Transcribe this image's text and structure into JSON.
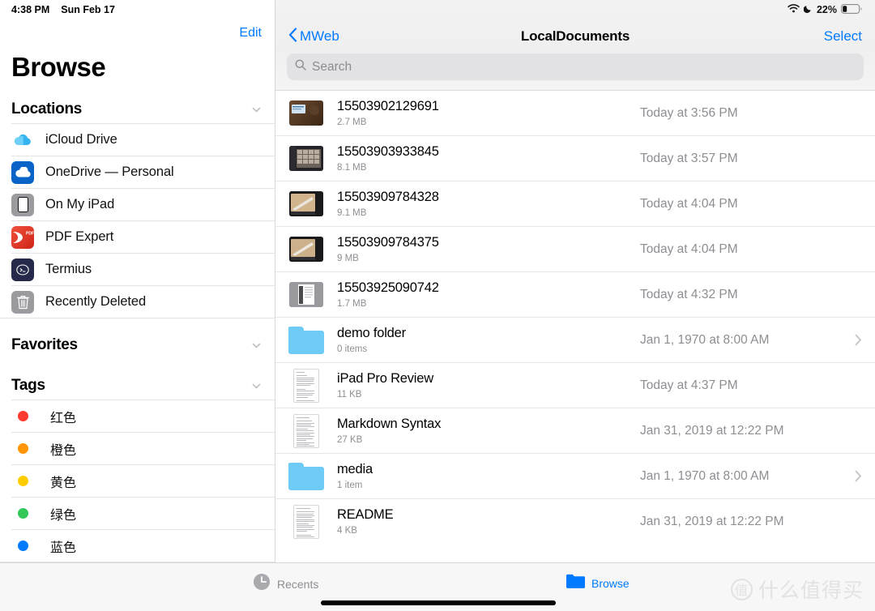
{
  "status_bar": {
    "time": "4:38 PM",
    "date": "Sun Feb 17",
    "wifi_icon": "wifi-icon",
    "dnd_icon": "moon-icon",
    "battery_percent": "22%",
    "battery_icon": "battery-icon"
  },
  "sidebar": {
    "edit_label": "Edit",
    "title": "Browse",
    "sections": [
      {
        "name": "locations",
        "title": "Locations",
        "collapse_icon": "chevron-down-icon",
        "items": [
          {
            "label": "iCloud Drive",
            "icon": "icloud-icon"
          },
          {
            "label": "OneDrive — Personal",
            "icon": "onedrive-icon"
          },
          {
            "label": "On My iPad",
            "icon": "ipad-icon"
          },
          {
            "label": "PDF Expert",
            "icon": "pdf-expert-icon"
          },
          {
            "label": "Termius",
            "icon": "termius-icon"
          },
          {
            "label": "Recently Deleted",
            "icon": "trash-icon"
          }
        ]
      },
      {
        "name": "favorites",
        "title": "Favorites",
        "collapse_icon": "chevron-down-icon",
        "items": []
      },
      {
        "name": "tags",
        "title": "Tags",
        "collapse_icon": "chevron-down-icon",
        "items": [
          {
            "label": "红色",
            "color": "#ff3b30"
          },
          {
            "label": "橙色",
            "color": "#ff9500"
          },
          {
            "label": "黄色",
            "color": "#ffcc00"
          },
          {
            "label": "绿色",
            "color": "#34c759"
          },
          {
            "label": "蓝色",
            "color": "#007aff"
          }
        ]
      }
    ]
  },
  "main": {
    "back_label": "MWeb",
    "back_icon": "chevron-left-icon",
    "title": "LocalDocuments",
    "select_label": "Select",
    "search": {
      "placeholder": "Search",
      "icon": "search-icon",
      "value": ""
    },
    "files": [
      {
        "name": "15503902129691",
        "size": "2.7 MB",
        "date": "Today at 3:56 PM",
        "kind": "photo",
        "chevron": false
      },
      {
        "name": "15503903933845",
        "size": "8.1 MB",
        "date": "Today at 3:57 PM",
        "kind": "photo",
        "chevron": false
      },
      {
        "name": "15503909784328",
        "size": "9.1 MB",
        "date": "Today at 4:04 PM",
        "kind": "photo",
        "chevron": false
      },
      {
        "name": "15503909784375",
        "size": "9 MB",
        "date": "Today at 4:04 PM",
        "kind": "photo",
        "chevron": false
      },
      {
        "name": "15503925090742",
        "size": "1.7 MB",
        "date": "Today at 4:32 PM",
        "kind": "photo",
        "chevron": false
      },
      {
        "name": "demo folder",
        "size": "0 items",
        "date": "Jan 1, 1970 at 8:00 AM",
        "kind": "folder",
        "chevron": true
      },
      {
        "name": "iPad Pro Review",
        "size": "11 KB",
        "date": "Today at 4:37 PM",
        "kind": "document",
        "chevron": false
      },
      {
        "name": "Markdown Syntax",
        "size": "27 KB",
        "date": "Jan 31, 2019 at 12:22 PM",
        "kind": "document",
        "chevron": false
      },
      {
        "name": "media",
        "size": "1 item",
        "date": "Jan 1, 1970 at 8:00 AM",
        "kind": "folder",
        "chevron": true
      },
      {
        "name": "README",
        "size": "4 KB",
        "date": "Jan 31, 2019 at 12:22 PM",
        "kind": "document",
        "chevron": false
      }
    ]
  },
  "tabbar": {
    "tabs": [
      {
        "label": "Recents",
        "icon": "clock-icon",
        "active": false
      },
      {
        "label": "Browse",
        "icon": "folder-icon",
        "active": true
      }
    ]
  },
  "watermark": {
    "mark": "值",
    "text": "什么值得买"
  },
  "colors": {
    "accent": "#007aff",
    "secondary_text": "#8e8e93",
    "separator": "#e6e6e8"
  }
}
